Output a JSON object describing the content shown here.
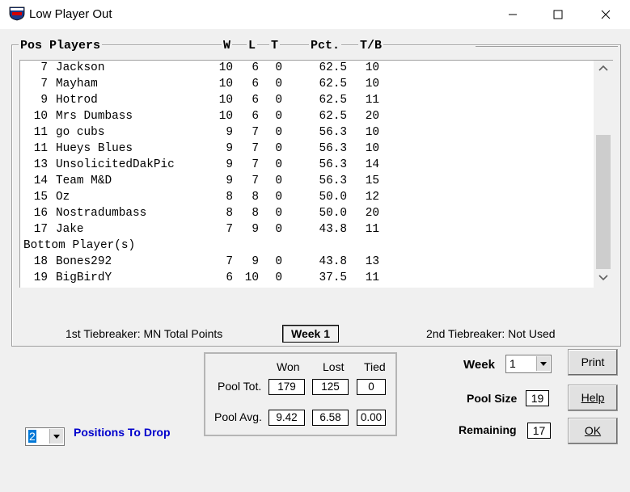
{
  "window": {
    "title": "Low Player Out"
  },
  "columns": {
    "pos_players": "Pos Players",
    "w": "W",
    "l": "L",
    "t": "T",
    "pct": "Pct.",
    "tb": "T/B"
  },
  "rows": [
    {
      "pos": "7",
      "name": "Jackson",
      "w": "10",
      "l": "6",
      "t": "0",
      "pct": "62.5",
      "tb": "10"
    },
    {
      "pos": "7",
      "name": "Mayham",
      "w": "10",
      "l": "6",
      "t": "0",
      "pct": "62.5",
      "tb": "10"
    },
    {
      "pos": "9",
      "name": "Hotrod",
      "w": "10",
      "l": "6",
      "t": "0",
      "pct": "62.5",
      "tb": "11"
    },
    {
      "pos": "10",
      "name": "Mrs Dumbass",
      "w": "10",
      "l": "6",
      "t": "0",
      "pct": "62.5",
      "tb": "20"
    },
    {
      "pos": "11",
      "name": "go cubs",
      "w": "9",
      "l": "7",
      "t": "0",
      "pct": "56.3",
      "tb": "10"
    },
    {
      "pos": "11",
      "name": "Hueys Blues",
      "w": "9",
      "l": "7",
      "t": "0",
      "pct": "56.3",
      "tb": "10"
    },
    {
      "pos": "13",
      "name": "UnsolicitedDakPic",
      "w": "9",
      "l": "7",
      "t": "0",
      "pct": "56.3",
      "tb": "14"
    },
    {
      "pos": "14",
      "name": "Team M&D",
      "w": "9",
      "l": "7",
      "t": "0",
      "pct": "56.3",
      "tb": "15"
    },
    {
      "pos": "15",
      "name": "Oz",
      "w": "8",
      "l": "8",
      "t": "0",
      "pct": "50.0",
      "tb": "12"
    },
    {
      "pos": "16",
      "name": "Nostradumbass",
      "w": "8",
      "l": "8",
      "t": "0",
      "pct": "50.0",
      "tb": "20"
    },
    {
      "pos": "17",
      "name": "Jake",
      "w": "7",
      "l": "9",
      "t": "0",
      "pct": "43.8",
      "tb": "11"
    },
    {
      "section": "Bottom Player(s)"
    },
    {
      "pos": "18",
      "name": "Bones292",
      "w": "7",
      "l": "9",
      "t": "0",
      "pct": "43.8",
      "tb": "13"
    },
    {
      "pos": "19",
      "name": "BigBirdY",
      "w": "6",
      "l": "10",
      "t": "0",
      "pct": "37.5",
      "tb": "11"
    }
  ],
  "footer": {
    "tiebreaker1": "1st Tiebreaker: MN Total Points",
    "week_label": "Week 1",
    "tiebreaker2": "2nd Tiebreaker: Not Used"
  },
  "pool": {
    "hdr_won": "Won",
    "hdr_lost": "Lost",
    "hdr_tied": "Tied",
    "tot_label": "Pool Tot.",
    "tot_won": "179",
    "tot_lost": "125",
    "tot_tied": "0",
    "avg_label": "Pool Avg.",
    "avg_won": "9.42",
    "avg_lost": "6.58",
    "avg_tied": "0.00"
  },
  "drop": {
    "value": "2",
    "label": "Positions To Drop"
  },
  "right": {
    "week_label": "Week",
    "week_value": "1",
    "pool_size_label": "Pool Size",
    "pool_size_value": "19",
    "remaining_label": "Remaining",
    "remaining_value": "17",
    "print": "Print",
    "help": "Help",
    "ok": "OK"
  },
  "colors": {
    "positions_label": "#0000cc",
    "selection": "#0078d7"
  }
}
